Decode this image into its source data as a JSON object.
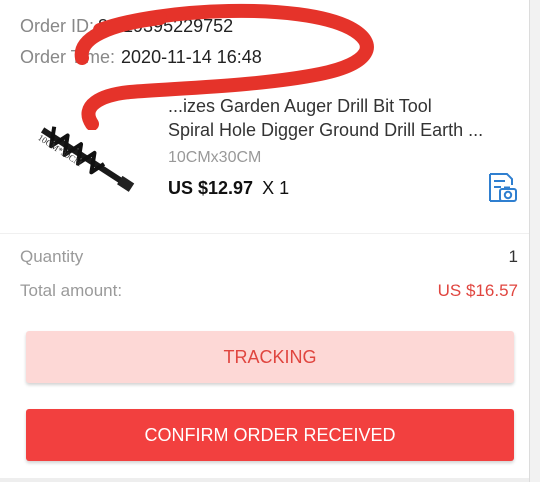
{
  "order": {
    "id_label": "Order ID:",
    "id_value": "8...19395229752",
    "time_label": "Order Time:",
    "time_value": "2020-11-14 16:48"
  },
  "product": {
    "title_line1": "...izes Garden Auger Drill Bit Tool",
    "title_line2": "Spiral Hole Digger Ground Drill Earth ...",
    "variant": "10CMx30CM",
    "price": "US $12.97",
    "quantity_text": "X 1",
    "image_caption": "10CM*30CM",
    "snapshot_icon": "order-snapshot-icon"
  },
  "summary": {
    "quantity_label": "Quantity",
    "quantity_value": "1",
    "total_label": "Total amount:",
    "total_value": "US $16.57"
  },
  "buttons": {
    "tracking": "TRACKING",
    "confirm": "CONFIRM ORDER RECEIVED"
  },
  "colors": {
    "accent_red": "#e0453f",
    "confirm_bg": "#f2403f",
    "tracking_bg": "#fdd8d6",
    "scribble": "#e5332a",
    "icon_blue": "#2f7fd0"
  }
}
